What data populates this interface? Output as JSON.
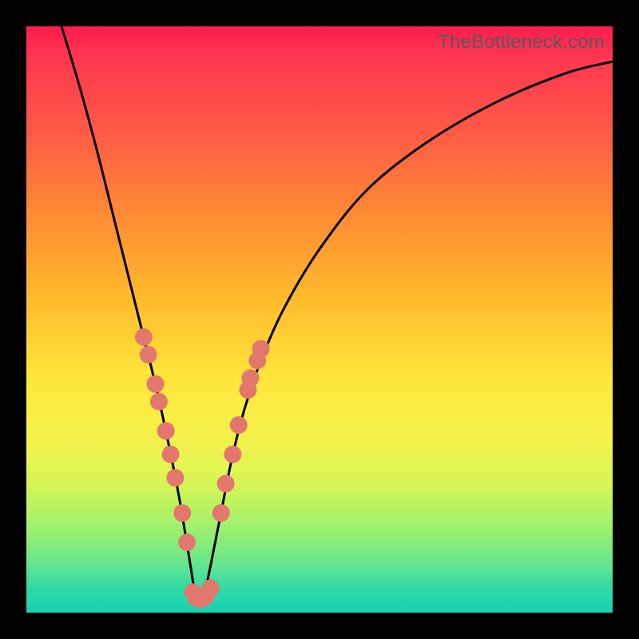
{
  "watermark": "TheBottleneck.com",
  "colors": {
    "frame": "#000000",
    "curve": "#000000",
    "marker": "#e3776d",
    "gradient_top": "#ff1c4d",
    "gradient_bottom": "#15d1b3"
  },
  "chart_data": {
    "type": "line",
    "title": "",
    "xlabel": "",
    "ylabel": "",
    "xlim": [
      0,
      100
    ],
    "ylim": [
      0,
      100
    ],
    "grid": false,
    "legend": false,
    "notes": "V-shaped bottleneck curve on rainbow gradient. Axes have no visible tick labels; x/y scaled 0-100. Minimum near x≈29, y≈2. Salmon-colored markers cluster on both branches near the trough.",
    "series": [
      {
        "name": "bottleneck-curve",
        "x": [
          6,
          9,
          12,
          15,
          18,
          20,
          22,
          24,
          26,
          28,
          29,
          30,
          31,
          33,
          35,
          37,
          40,
          44,
          50,
          58,
          68,
          80,
          92,
          100
        ],
        "y": [
          100,
          90,
          79,
          67,
          55,
          47,
          39,
          30,
          20,
          8,
          2,
          2,
          6,
          16,
          26,
          34,
          43,
          52,
          62,
          72,
          80,
          87,
          92,
          94
        ]
      }
    ],
    "markers": {
      "left_branch": [
        {
          "x": 20.0,
          "y": 47
        },
        {
          "x": 20.8,
          "y": 44
        },
        {
          "x": 22.0,
          "y": 39
        },
        {
          "x": 22.6,
          "y": 36
        },
        {
          "x": 23.8,
          "y": 31
        },
        {
          "x": 24.6,
          "y": 27
        },
        {
          "x": 25.4,
          "y": 23
        },
        {
          "x": 26.6,
          "y": 17
        },
        {
          "x": 27.4,
          "y": 12
        }
      ],
      "trough": [
        {
          "x": 28.4,
          "y": 3.5
        },
        {
          "x": 29.0,
          "y": 2.5
        },
        {
          "x": 29.8,
          "y": 2.3
        },
        {
          "x": 30.6,
          "y": 2.8
        },
        {
          "x": 31.4,
          "y": 4.2
        }
      ],
      "right_branch": [
        {
          "x": 33.2,
          "y": 17
        },
        {
          "x": 34.0,
          "y": 22
        },
        {
          "x": 35.2,
          "y": 27
        },
        {
          "x": 36.2,
          "y": 32
        },
        {
          "x": 37.8,
          "y": 38
        },
        {
          "x": 38.2,
          "y": 40
        },
        {
          "x": 39.4,
          "y": 43
        },
        {
          "x": 40.0,
          "y": 45
        }
      ]
    }
  }
}
